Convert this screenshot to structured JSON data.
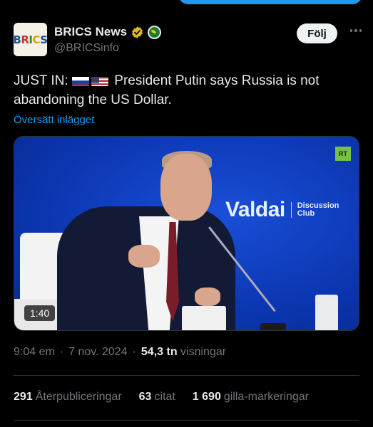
{
  "account": {
    "display_name": "BRICS News",
    "handle": "@BRICSinfo",
    "avatar_text": [
      "B",
      "R",
      "I",
      "C",
      "S"
    ],
    "follow_label": "Följ"
  },
  "tweet": {
    "prefix": "JUST IN:",
    "flags": [
      "flag-russia",
      "flag-usa"
    ],
    "text": "President Putin says Russia is not abandoning the US Dollar.",
    "translate_label": "Översätt inlägget"
  },
  "media": {
    "duration": "1:40",
    "badge": "RT",
    "logo_main": "Valdai",
    "logo_sub_1": "Discussion",
    "logo_sub_2": "Club"
  },
  "meta": {
    "time": "9:04 em",
    "separator_1": "·",
    "date": "7 nov. 2024",
    "separator_2": "·",
    "views_count": "54,3 tn",
    "views_label": "visningar"
  },
  "stats": {
    "reposts_count": "291",
    "reposts_label": "Återpubliceringar",
    "quotes_count": "63",
    "quotes_label": "citat",
    "likes_count": "1 690",
    "likes_label": "gilla-markeringar"
  },
  "colors": {
    "accent": "#1d9bf0",
    "verified": "#e2b719",
    "background": "#000000"
  }
}
